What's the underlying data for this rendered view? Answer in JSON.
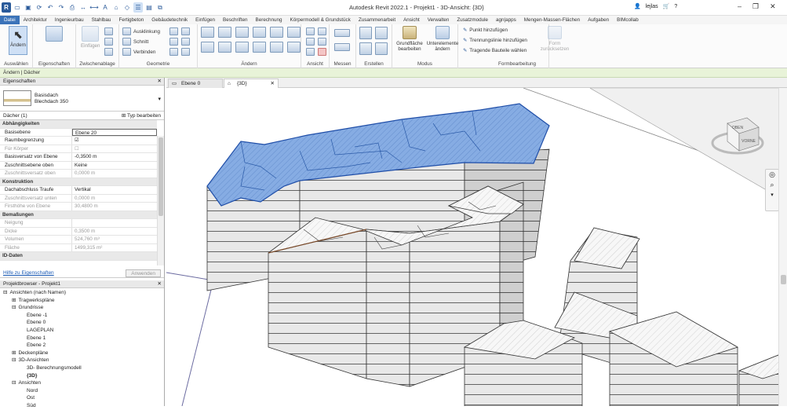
{
  "app": {
    "title": "Autodesk Revit 2022.1 - Projekt1 - 3D-Ansicht: {3D}",
    "user": "lejlas"
  },
  "menu_tabs": [
    "Datei",
    "Architektur",
    "Ingenieurbau",
    "Stahlbau",
    "Fertigbeton",
    "Gebäudetechnik",
    "Einfügen",
    "Beschriften",
    "Berechnung",
    "Körpermodell & Grundstück",
    "Zusammenarbeit",
    "Ansicht",
    "Verwalten",
    "Zusatzmodule",
    "agn|apps",
    "Mengen-Massen-Flächen",
    "Aufgaben",
    "BIMcollab"
  ],
  "ribbon": {
    "aendern": "Ändern",
    "auswaehlen": "Auswählen",
    "eigenschaften": "Eigenschaften",
    "einfuegen": "Einfügen",
    "zwischenablage": "Zwischenablage",
    "ausklinkung": "Ausklinkung",
    "schnitt": "Schnitt",
    "verbinden": "Verbinden",
    "geometrie": "Geometrie",
    "aendern_panel": "Ändern",
    "ansicht": "Ansicht",
    "messen": "Messen",
    "erstellen": "Erstellen",
    "grundflaeche_l1": "Grundfläche",
    "grundflaeche_l2": "bearbeiten",
    "unterelemente_l1": "Unterelemente",
    "unterelemente_l2": "ändern",
    "modus": "Modus",
    "punkt": "Punkt hinzufügen",
    "trennungslinie": "Trennungslinie hinzufügen",
    "tragende": "Tragende Bauteile wählen",
    "form_l1": "Form",
    "form_l2": "zurücksetzen",
    "formbearbeitung": "Formbearbeitung"
  },
  "modebar": "Ändern | Dächer",
  "properties": {
    "header": "Eigenschaften",
    "type_line1": "Basisdach",
    "type_line2": "Blechdach 350",
    "filter": "Dächer (1)",
    "edit_type": "Typ bearbeiten",
    "rows": [
      {
        "k": "Abhängigkeiten",
        "v": "",
        "cat": true
      },
      {
        "k": "Basisebene",
        "v": "Ebene 20",
        "sel": true
      },
      {
        "k": "Raumbegrenzung",
        "v": "☑"
      },
      {
        "k": "Für Körper",
        "v": "☐",
        "dis": true
      },
      {
        "k": "Basisversatz von Ebene",
        "v": "-0,3500 m"
      },
      {
        "k": "Zuschnittsebene oben",
        "v": "Keine"
      },
      {
        "k": "Zuschnittsversatz oben",
        "v": "0,0000 m",
        "dis": true
      },
      {
        "k": "Konstruktion",
        "v": "",
        "cat": true
      },
      {
        "k": "Dachabschluss Traufe",
        "v": "Vertikal"
      },
      {
        "k": "Zuschnittsversatz unten",
        "v": "0,0000 m",
        "dis": true
      },
      {
        "k": "Firsthöhe von Ebene",
        "v": "30,4800 m",
        "dis": true
      },
      {
        "k": "Bemaßungen",
        "v": "",
        "cat": true
      },
      {
        "k": "Neigung",
        "v": "",
        "dis": true
      },
      {
        "k": "Dicke",
        "v": "0,3500 m",
        "dis": true
      },
      {
        "k": "Volumen",
        "v": "524,760 m³",
        "dis": true
      },
      {
        "k": "Fläche",
        "v": "1499,315 m²",
        "dis": true
      },
      {
        "k": "ID-Daten",
        "v": "",
        "cat": true
      }
    ],
    "help_link": "Hilfe zu Eigenschaften",
    "apply": "Anwenden"
  },
  "browser": {
    "header": "Projektbrowser - Projekt1",
    "nodes": [
      {
        "t": "Ansichten (nach Namen)",
        "l": 0,
        "e": "⊟"
      },
      {
        "t": "Tragwerkspläne",
        "l": 1,
        "e": "⊞"
      },
      {
        "t": "Grundrisse",
        "l": 1,
        "e": "⊟"
      },
      {
        "t": "Ebene -1",
        "l": 2,
        "e": ""
      },
      {
        "t": "Ebene 0",
        "l": 2,
        "e": ""
      },
      {
        "t": "LAGEPLAN",
        "l": 2,
        "e": ""
      },
      {
        "t": "Ebene 1",
        "l": 2,
        "e": ""
      },
      {
        "t": "Ebene 2",
        "l": 2,
        "e": ""
      },
      {
        "t": "Deckenpläne",
        "l": 1,
        "e": "⊞"
      },
      {
        "t": "3D-Ansichten",
        "l": 1,
        "e": "⊟"
      },
      {
        "t": "3D- Berechnungsmodell",
        "l": 2,
        "e": ""
      },
      {
        "t": "{3D}",
        "l": 2,
        "e": "",
        "b": true
      },
      {
        "t": "Ansichten",
        "l": 1,
        "e": "⊟"
      },
      {
        "t": "Nord",
        "l": 2,
        "e": ""
      },
      {
        "t": "Ost",
        "l": 2,
        "e": ""
      },
      {
        "t": "Süd",
        "l": 2,
        "e": ""
      }
    ]
  },
  "view_tabs": [
    "Ebene 0",
    "{3D}"
  ],
  "viewcube": {
    "top": "OBEN",
    "front": "VORNE"
  },
  "colors": {
    "accent": "#3b73b9",
    "roof_selected": "#7fa7e0",
    "modebar": "#e8f3d8"
  }
}
